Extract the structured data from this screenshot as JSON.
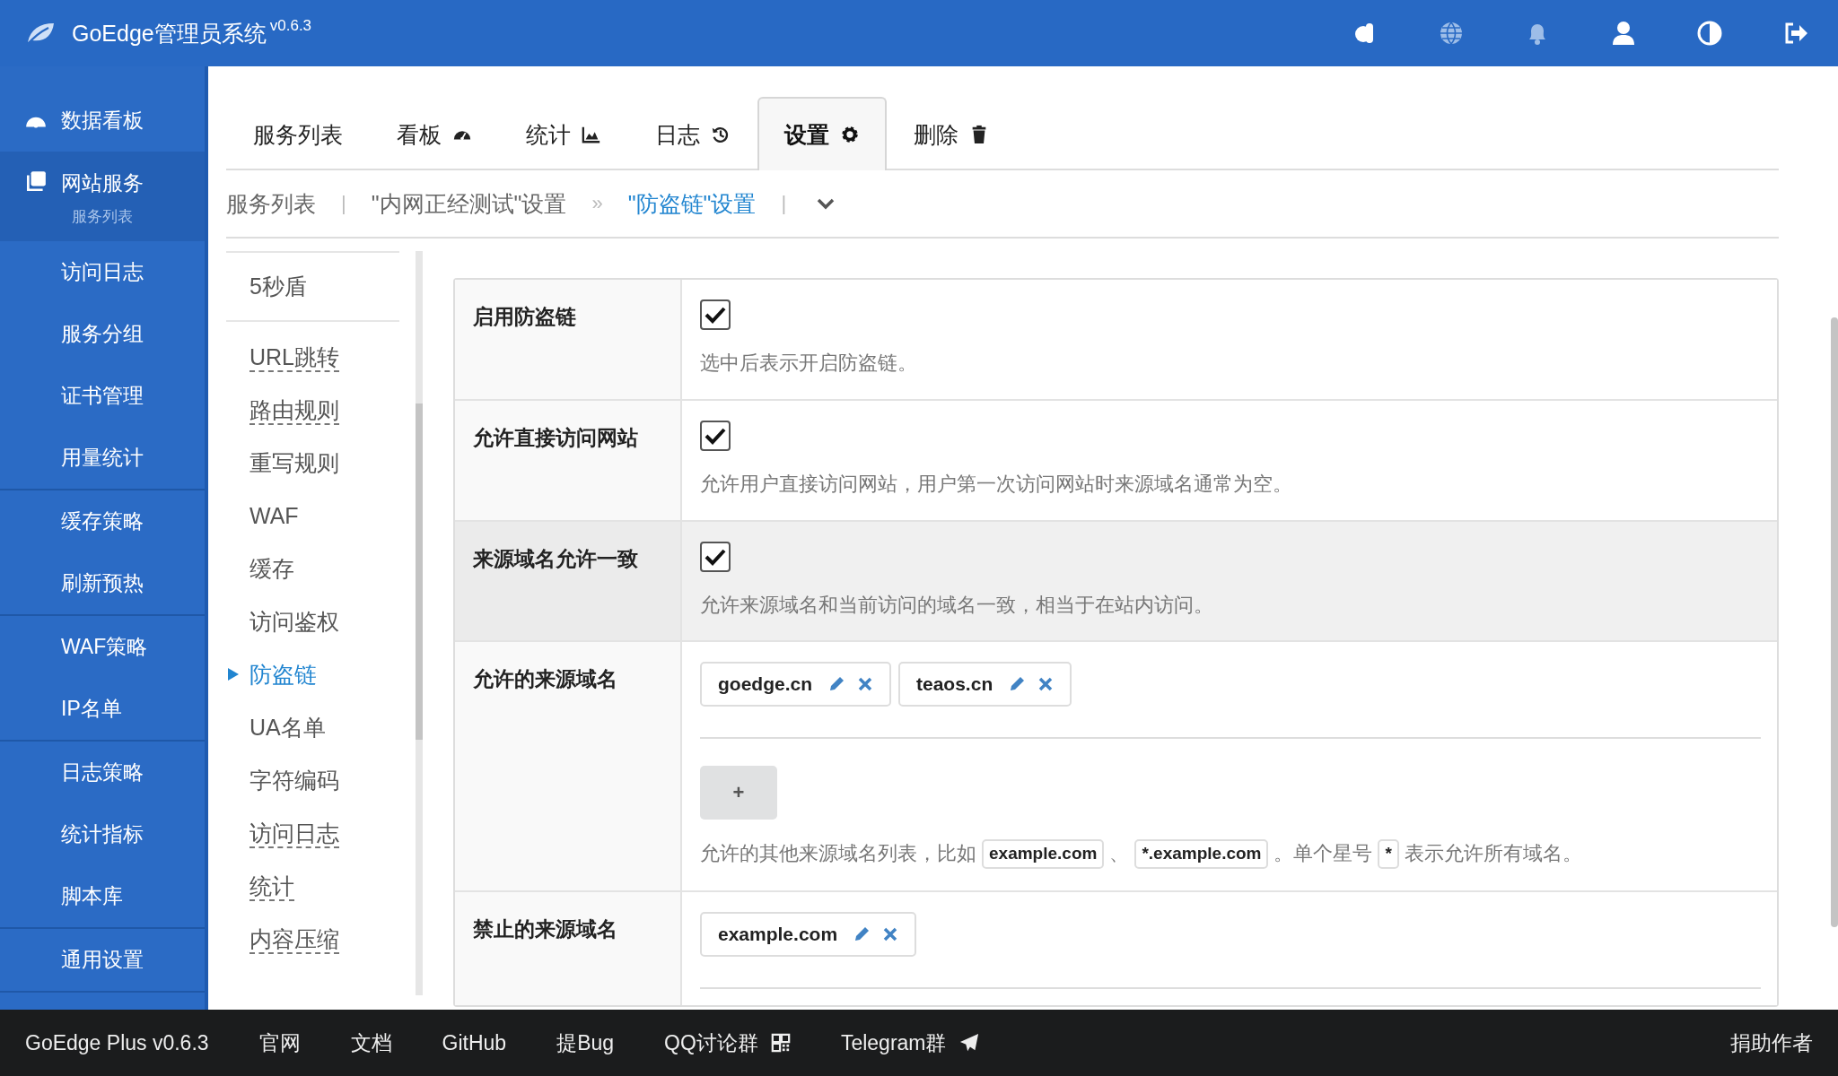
{
  "header": {
    "title": "GoEdge管理员系统",
    "version": "v0.6.3"
  },
  "sidebar": {
    "sections": [
      {
        "items": [
          {
            "label": "数据看板",
            "kind": "dashboard",
            "selected": false
          },
          {
            "label": "网站服务",
            "kind": "pages",
            "selected": true,
            "sub": "服务列表"
          },
          {
            "label": "访问日志",
            "kind": "plain",
            "selected": false
          },
          {
            "label": "服务分组",
            "kind": "plain",
            "selected": false
          },
          {
            "label": "证书管理",
            "kind": "plain",
            "selected": false
          },
          {
            "label": "用量统计",
            "kind": "plain",
            "selected": false
          }
        ]
      },
      {
        "items": [
          {
            "label": "缓存策略",
            "kind": "plain",
            "selected": false
          },
          {
            "label": "刷新预热",
            "kind": "plain",
            "selected": false
          }
        ]
      },
      {
        "items": [
          {
            "label": "WAF策略",
            "kind": "plain",
            "selected": false
          },
          {
            "label": "IP名单",
            "kind": "plain",
            "selected": false
          }
        ]
      },
      {
        "items": [
          {
            "label": "日志策略",
            "kind": "plain",
            "selected": false
          },
          {
            "label": "统计指标",
            "kind": "plain",
            "selected": false
          },
          {
            "label": "脚本库",
            "kind": "plain",
            "selected": false
          }
        ]
      },
      {
        "items": [
          {
            "label": "通用设置",
            "kind": "plain",
            "selected": false
          }
        ]
      }
    ]
  },
  "tabs": [
    {
      "label": "服务列表",
      "kind": "plain",
      "selected": false
    },
    {
      "label": "看板",
      "kind": "dashboard",
      "selected": false
    },
    {
      "label": "统计",
      "kind": "chart",
      "selected": false
    },
    {
      "label": "日志",
      "kind": "history",
      "selected": false
    },
    {
      "label": "设置",
      "kind": "gear",
      "selected": true
    },
    {
      "label": "删除",
      "kind": "trash",
      "selected": false
    }
  ],
  "breadcrumb": [
    {
      "kind": "link",
      "text": "服务列表"
    },
    {
      "kind": "separator",
      "text": "|"
    },
    {
      "kind": "link",
      "text": "\"内网正经测试\"设置"
    },
    {
      "kind": "separator",
      "text": "»"
    },
    {
      "kind": "current",
      "text": "\"防盗链\"设置"
    },
    {
      "kind": "separator",
      "text": "|"
    },
    {
      "kind": "dropdown"
    }
  ],
  "submenu": {
    "groups": [
      {
        "items": [
          {
            "label": "5秒盾",
            "configured": false,
            "selected": false
          }
        ]
      },
      {
        "items": [
          {
            "label": "URL跳转",
            "configured": true,
            "selected": false
          },
          {
            "label": "路由规则",
            "configured": true,
            "selected": false
          },
          {
            "label": "重写规则",
            "configured": false,
            "selected": false
          },
          {
            "label": "WAF",
            "configured": false,
            "selected": false
          },
          {
            "label": "缓存",
            "configured": false,
            "selected": false
          },
          {
            "label": "访问鉴权",
            "configured": false,
            "selected": false
          },
          {
            "label": "防盗链",
            "configured": false,
            "selected": true
          },
          {
            "label": "UA名单",
            "configured": false,
            "selected": false
          },
          {
            "label": "字符编码",
            "configured": false,
            "selected": false
          },
          {
            "label": "访问日志",
            "configured": true,
            "selected": false
          },
          {
            "label": "统计",
            "configured": true,
            "selected": false
          },
          {
            "label": "内容压缩",
            "configured": true,
            "selected": false
          }
        ]
      }
    ]
  },
  "form": {
    "rows": [
      {
        "label": "启用防盗链",
        "kind": "checkbox",
        "checked": true,
        "highlighted": false,
        "help": [
          {
            "kind": "text",
            "text": "选中后表示开启防盗链。"
          }
        ]
      },
      {
        "label": "允许直接访问网站",
        "kind": "checkbox",
        "checked": true,
        "highlighted": false,
        "help": [
          {
            "kind": "text",
            "text": "允许用户直接访问网站，用户第一次访问网站时来源域名通常为空。"
          }
        ]
      },
      {
        "label": "来源域名允许一致",
        "kind": "checkbox",
        "checked": true,
        "highlighted": true,
        "help": [
          {
            "kind": "text",
            "text": "允许来源域名和当前访问的域名一致，相当于在站内访问。"
          }
        ]
      },
      {
        "label": "允许的来源域名",
        "kind": "domains",
        "highlighted": false,
        "tags": [
          "goedge.cn",
          "teaos.cn"
        ],
        "add_button": "+",
        "help": [
          {
            "kind": "text",
            "text": "允许的其他来源域名列表，比如"
          },
          {
            "kind": "code",
            "text": "example.com"
          },
          {
            "kind": "text",
            "text": "、"
          },
          {
            "kind": "code",
            "text": "*.example.com"
          },
          {
            "kind": "text",
            "text": "。单个星号"
          },
          {
            "kind": "code",
            "text": "*"
          },
          {
            "kind": "text",
            "text": "表示允许所有域名。"
          }
        ]
      },
      {
        "label": "禁止的来源域名",
        "kind": "domains",
        "highlighted": false,
        "tags": [
          "example.com"
        ]
      }
    ]
  },
  "footer": {
    "links": [
      {
        "text": "GoEdge Plus v0.6.3",
        "kind": "plain"
      },
      {
        "text": "官网",
        "kind": "plain"
      },
      {
        "text": "文档",
        "kind": "plain"
      },
      {
        "text": "GitHub",
        "kind": "plain"
      },
      {
        "text": "提Bug",
        "kind": "plain"
      },
      {
        "text": "QQ讨论群",
        "kind": "qr"
      },
      {
        "text": "Telegram群",
        "kind": "plane"
      }
    ],
    "right": "捐助作者"
  }
}
